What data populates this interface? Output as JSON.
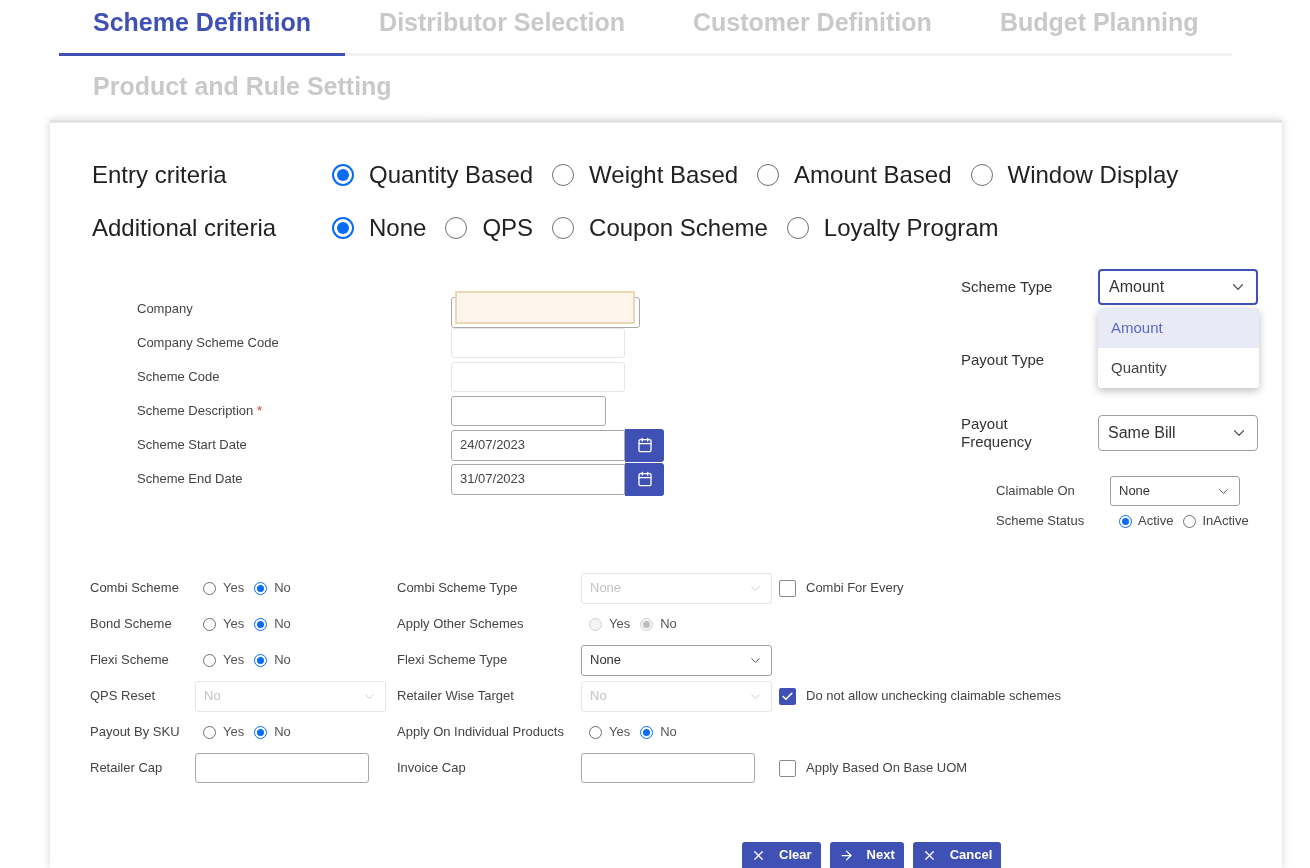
{
  "tabs": [
    {
      "label": "Scheme Definition",
      "selected": true
    },
    {
      "label": "Distributor Selection",
      "selected": false
    },
    {
      "label": "Customer Definition",
      "selected": false
    },
    {
      "label": "Budget Planning",
      "selected": false
    },
    {
      "label": "Product and Rule Setting",
      "selected": false
    }
  ],
  "criteria": [
    {
      "label": "Entry criteria",
      "options": [
        {
          "label": "Quantity Based",
          "selected": true
        },
        {
          "label": "Weight Based",
          "selected": false
        },
        {
          "label": "Amount Based",
          "selected": false
        },
        {
          "label": "Window Display",
          "selected": false
        }
      ]
    },
    {
      "label": "Additional criteria",
      "options": [
        {
          "label": "None",
          "selected": true
        },
        {
          "label": "QPS",
          "selected": false
        },
        {
          "label": "Coupon Scheme",
          "selected": false
        },
        {
          "label": "Loyalty Program",
          "selected": false
        }
      ]
    }
  ],
  "scheme_fields": [
    {
      "kind": "autofill",
      "label": "Company",
      "disabled": false
    },
    {
      "kind": "text",
      "label": "Company Scheme Code",
      "disabled": true
    },
    {
      "kind": "text",
      "label": "Scheme Code",
      "disabled": true
    },
    {
      "kind": "short",
      "label": "Scheme Description",
      "required_mark": "*",
      "disabled": false
    },
    {
      "kind": "date",
      "label": "Scheme Start Date",
      "value": "24/07/2023",
      "disabled": false
    },
    {
      "kind": "date",
      "label": "Scheme End Date",
      "value": "31/07/2023",
      "disabled": false
    }
  ],
  "payout_settings": [
    {
      "kind": "dropdown",
      "label": "Scheme Type",
      "value": "Amount",
      "expanded": true,
      "options": [
        {
          "label": "Amount",
          "selected": true
        },
        {
          "label": "Quantity",
          "selected": false
        }
      ]
    },
    {
      "kind": "covered",
      "label": "Payout Type"
    },
    {
      "kind": "dropdown",
      "label": "Payout Frequency",
      "value": "Same Bill",
      "expanded": false
    }
  ],
  "claimable_on": {
    "label": "Claimable On",
    "value": "None"
  },
  "scheme_status": {
    "label": "Scheme Status",
    "options": [
      {
        "label": "Active",
        "selected": true
      },
      {
        "label": "InActive",
        "selected": false
      }
    ]
  },
  "options_grid": [
    {
      "cells": [
        {
          "kind": "radio",
          "label": "Combi Scheme",
          "disabled": false,
          "options": [
            {
              "label": "Yes",
              "selected": false
            },
            {
              "label": "No",
              "selected": true
            }
          ]
        },
        {
          "kind": "select",
          "label": "Combi Scheme Type",
          "value": "None",
          "disabled": true
        },
        {
          "kind": "checkbox",
          "label": "Combi For Every",
          "checked": false
        }
      ]
    },
    {
      "cells": [
        {
          "kind": "radio",
          "label": "Bond Scheme",
          "disabled": false,
          "options": [
            {
              "label": "Yes",
              "selected": false
            },
            {
              "label": "No",
              "selected": true
            }
          ]
        },
        {
          "kind": "radio",
          "label": "Apply Other Schemes",
          "disabled": true,
          "options": [
            {
              "label": "Yes",
              "selected": false
            },
            {
              "label": "No",
              "selected": true
            }
          ]
        }
      ]
    },
    {
      "cells": [
        {
          "kind": "radio",
          "label": "Flexi Scheme",
          "disabled": false,
          "options": [
            {
              "label": "Yes",
              "selected": false
            },
            {
              "label": "No",
              "selected": true
            }
          ]
        },
        {
          "kind": "select",
          "label": "Flexi Scheme Type",
          "value": "None",
          "disabled": false
        }
      ]
    },
    {
      "cells": [
        {
          "kind": "select",
          "label": "QPS Reset",
          "value": "No",
          "disabled": true
        },
        {
          "kind": "select",
          "label": "Retailer Wise Target",
          "value": "No",
          "disabled": true
        },
        {
          "kind": "checkbox",
          "label": "Do not allow unchecking claimable schemes",
          "checked": true
        }
      ]
    },
    {
      "cells": [
        {
          "kind": "radio",
          "label": "Payout By SKU",
          "disabled": false,
          "options": [
            {
              "label": "Yes",
              "selected": false
            },
            {
              "label": "No",
              "selected": true
            }
          ]
        },
        {
          "kind": "radio",
          "label": "Apply On Individual Products",
          "disabled": false,
          "options": [
            {
              "label": "Yes",
              "selected": false
            },
            {
              "label": "No",
              "selected": true
            }
          ]
        }
      ]
    },
    {
      "cells": [
        {
          "kind": "input",
          "label": "Retailer Cap"
        },
        {
          "kind": "input",
          "label": "Invoice Cap"
        },
        {
          "kind": "checkbox",
          "label": "Apply Based On Base UOM",
          "checked": false
        }
      ]
    }
  ],
  "buttons": [
    {
      "kind": "clear",
      "label": "Clear"
    },
    {
      "kind": "next",
      "label": "Next"
    },
    {
      "kind": "cancel",
      "label": "Cancel"
    }
  ]
}
